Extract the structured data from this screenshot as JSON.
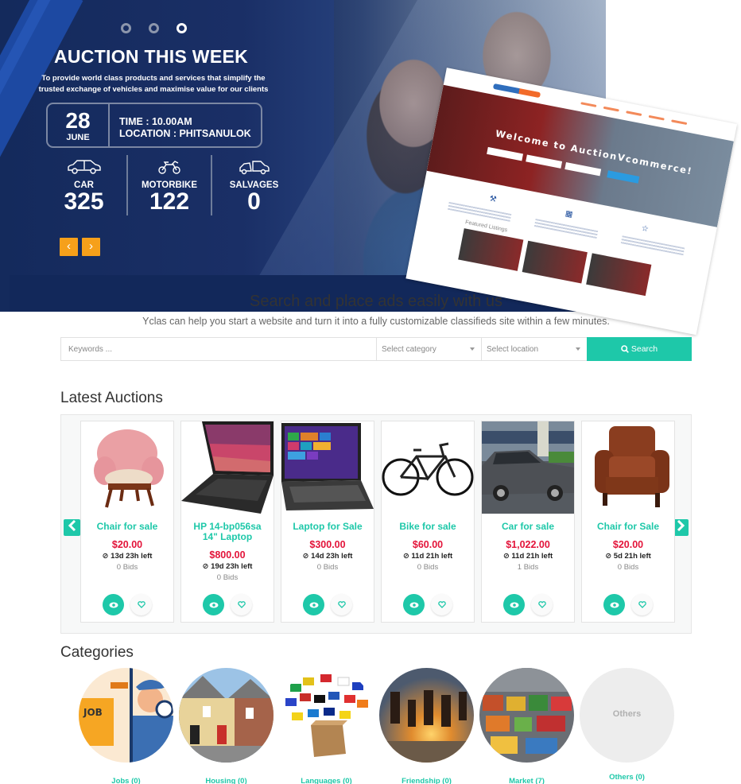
{
  "hero": {
    "slides_total": 3,
    "active_slide": 3,
    "title": "AUCTION THIS WEEK",
    "subtitle_line1": "To provide world class products and services that simplify the",
    "subtitle_line2": "trusted exchange of vehicles and maximise value for our clients",
    "date_day": "28",
    "date_month": "JUNE",
    "time": "TIME : 10.00AM",
    "location": "LOCATION : PHITSANULOK",
    "stats": [
      {
        "icon": "car-icon",
        "label": "CAR",
        "value": "325"
      },
      {
        "icon": "motorbike-icon",
        "label": "MOTORBIKE",
        "value": "122"
      },
      {
        "icon": "salvage-car-icon",
        "label": "SALVAGES",
        "value": "0"
      }
    ],
    "prev_label": "‹",
    "next_label": "›",
    "embedded_screenshot": {
      "headline": "Welcome to AuctionVcommerce!",
      "section_label": "Featured Listings"
    }
  },
  "search": {
    "title": "Search and place ads easily with us",
    "subtitle": "Yclas can help you start a website and turn it into a fully customizable classifieds site within a few minutes.",
    "keywords_placeholder": "Keywords ...",
    "category_placeholder": "Select category",
    "location_placeholder": "Select location",
    "button_label": "Search"
  },
  "auctions": {
    "title": "Latest Auctions",
    "items": [
      {
        "title": "Chair for sale",
        "price": "$20.00",
        "time_left": "13d 23h left",
        "bids": "0 Bids",
        "image": "pink-armchair"
      },
      {
        "title": "HP 14-bp056sa 14\" Laptop",
        "price": "$800.00",
        "time_left": "19d 23h left",
        "bids": "0 Bids",
        "image": "black-laptop"
      },
      {
        "title": "Laptop for Sale",
        "price": "$300.00",
        "time_left": "14d 23h left",
        "bids": "0 Bids",
        "image": "windows-laptop"
      },
      {
        "title": "Bike for sale",
        "price": "$60.00",
        "time_left": "11d 21h left",
        "bids": "0 Bids",
        "image": "road-bike"
      },
      {
        "title": "Car for sale",
        "price": "$1,022.00",
        "time_left": "11d 21h left",
        "bids": "1 Bids",
        "image": "grey-sedan"
      },
      {
        "title": "Chair for Sale",
        "price": "$20.00",
        "time_left": "5d 21h left",
        "bids": "0 Bids",
        "image": "leather-armchair"
      }
    ]
  },
  "categories": {
    "title": "Categories",
    "items": [
      {
        "label": "Jobs (0)",
        "image": "job-search-illustration"
      },
      {
        "label": "Housing (0)",
        "image": "terraced-houses"
      },
      {
        "label": "Languages (0)",
        "image": "flags-box"
      },
      {
        "label": "Friendship (0)",
        "image": "friends-jumping-sunset"
      },
      {
        "label": "Market (7)",
        "image": "market-hall"
      },
      {
        "label": "Others (0)",
        "image": "placeholder",
        "placeholder_text": "Others"
      }
    ]
  },
  "colors": {
    "accent": "#1ec8a9",
    "price": "#e3143a",
    "hero_bg": "#1a2f66",
    "hero_arrow": "#f6a01a"
  }
}
